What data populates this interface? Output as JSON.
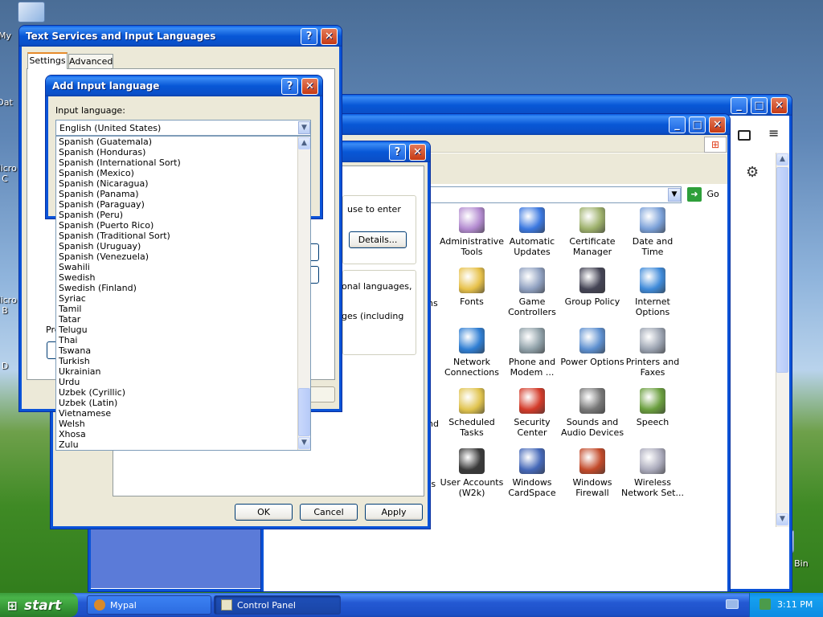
{
  "desktop": {
    "icons": [
      {
        "label": "My",
        "icon": "my-computer-icon"
      },
      {
        "label": "Dat",
        "icon": "documents-icon"
      },
      {
        "label": "Micro C",
        "icon": "app-icon"
      },
      {
        "label": "Micro B",
        "icon": "app-icon"
      },
      {
        "label": "D",
        "icon": "app-icon"
      }
    ],
    "recycle_bin": "Recycle Bin"
  },
  "control_panel": {
    "title": "Control Panel",
    "address_go": "Go",
    "items": [
      {
        "label": "Administrative Tools",
        "icon": "admin-tools-icon"
      },
      {
        "label": "Automatic Updates",
        "icon": "windows-flag-icon"
      },
      {
        "label": "Certificate Manager",
        "icon": "certificate-icon"
      },
      {
        "label": "Date and Time",
        "icon": "clock-icon"
      },
      {
        "label": "Fonts",
        "icon": "fonts-folder-icon"
      },
      {
        "label": "Game Controllers",
        "icon": "gamepad-icon"
      },
      {
        "label": "Group Policy",
        "icon": "users-icon"
      },
      {
        "label": "Internet Options",
        "icon": "globe-icon"
      },
      {
        "label": "Network Connections",
        "icon": "network-globe-icon"
      },
      {
        "label": "Phone and Modem ...",
        "icon": "phone-icon"
      },
      {
        "label": "Power Options",
        "icon": "battery-icon"
      },
      {
        "label": "Printers and Faxes",
        "icon": "printer-icon"
      },
      {
        "label": "Scheduled Tasks",
        "icon": "tasks-folder-icon"
      },
      {
        "label": "Security Center",
        "icon": "shield-icon"
      },
      {
        "label": "Sounds and Audio Devices",
        "icon": "speaker-icon"
      },
      {
        "label": "Speech",
        "icon": "speech-icon"
      },
      {
        "label": "User Accounts (W2k)",
        "icon": "user-key-icon"
      },
      {
        "label": "Windows CardSpace",
        "icon": "cardspace-icon"
      },
      {
        "label": "Windows Firewall",
        "icon": "firewall-icon"
      },
      {
        "label": "Wireless Network Set...",
        "icon": "wireless-icon"
      }
    ],
    "partial_left_labels": [
      "ns",
      "nd",
      "ts"
    ]
  },
  "regional_dialog": {
    "text1": "use to enter",
    "details_button": "Details...",
    "text2": "onal languages,",
    "text3": "ges (including",
    "ok": "OK",
    "cancel": "Cancel",
    "apply": "Apply"
  },
  "text_services": {
    "title": "Text Services and Input Languages",
    "tabs": [
      "Settings",
      "Advanced"
    ],
    "partial_label": "Pre"
  },
  "add_input": {
    "title": "Add Input language",
    "label": "Input language:",
    "selected": "English (United States)",
    "options": [
      "Spanish (Guatemala)",
      "Spanish (Honduras)",
      "Spanish (International Sort)",
      "Spanish (Mexico)",
      "Spanish (Nicaragua)",
      "Spanish (Panama)",
      "Spanish (Paraguay)",
      "Spanish (Peru)",
      "Spanish (Puerto Rico)",
      "Spanish (Traditional Sort)",
      "Spanish (Uruguay)",
      "Spanish (Venezuela)",
      "Swahili",
      "Swedish",
      "Swedish (Finland)",
      "Syriac",
      "Tamil",
      "Tatar",
      "Telugu",
      "Thai",
      "Tswana",
      "Turkish",
      "Ukrainian",
      "Urdu",
      "Uzbek (Cyrillic)",
      "Uzbek (Latin)",
      "Vietnamese",
      "Welsh",
      "Xhosa",
      "Zulu"
    ]
  },
  "taskbar": {
    "start": "start",
    "tasks": [
      "Mypal",
      "Control Panel"
    ],
    "time": "3:11 PM"
  },
  "title_buttons": {
    "help": "?",
    "close": "✕",
    "min": "_",
    "max": "□"
  }
}
